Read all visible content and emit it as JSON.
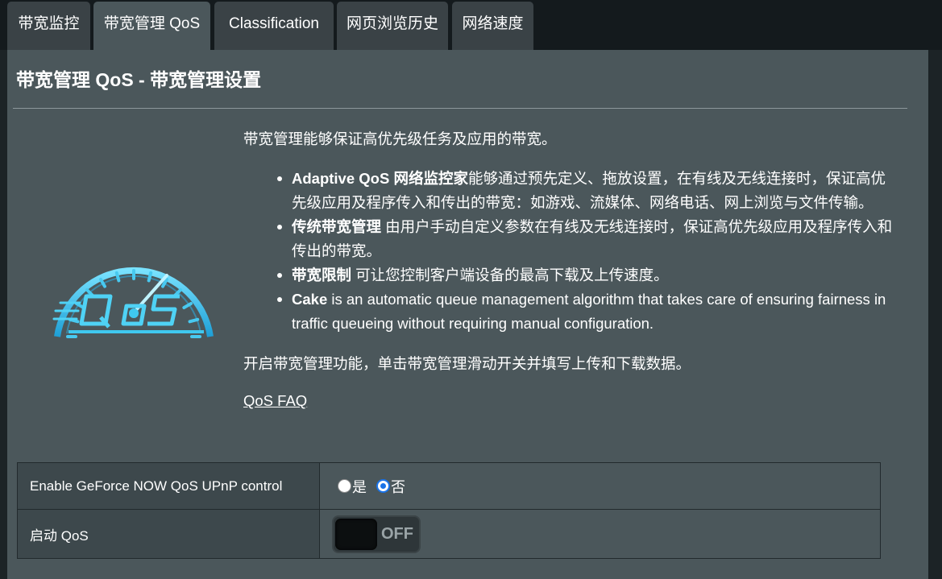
{
  "tabs": [
    {
      "label": "带宽监控",
      "active": false
    },
    {
      "label": "带宽管理 QoS",
      "active": true
    },
    {
      "label": "Classification",
      "active": false
    },
    {
      "label": "网页浏览历史",
      "active": false
    },
    {
      "label": "网络速度",
      "active": false
    }
  ],
  "page": {
    "title": "带宽管理 QoS - 带宽管理设置",
    "logo_icon": "qos-speedometer-icon",
    "intro": "带宽管理能够保证高优先级任务及应用的带宽。",
    "bullets": [
      {
        "bold": "Adaptive QoS 网络监控家",
        "text": "能够通过预先定义、拖放设置，在有线及无线连接时，保证高优先级应用及程序传入和传出的带宽：如游戏、流媒体、网络电话、网上浏览与文件传输。"
      },
      {
        "bold": "传统带宽管理",
        "text": " 由用户手动自定义参数在有线及无线连接时，保证高优先级应用及程序传入和传出的带宽。"
      },
      {
        "bold": "带宽限制",
        "text": " 可让您控制客户端设备的最高下载及上传速度。"
      },
      {
        "bold": "Cake",
        "text": " is an automatic queue management algorithm that takes care of ensuring fairness in traffic queueing without requiring manual configuration."
      }
    ],
    "note": "开启带宽管理功能，单击带宽管理滑动开关并填写上传和下载数据。",
    "faq_link": "QoS FAQ"
  },
  "settings": {
    "geforce": {
      "label": "Enable GeForce NOW QoS UPnP control",
      "options": [
        "是",
        "否"
      ],
      "selected": "否"
    },
    "qos": {
      "label": "启动 QoS",
      "state": "OFF"
    }
  },
  "colors": {
    "accent_blue": "#1a73e8",
    "logo_cyan": "#3fc8ef",
    "panel_bg": "#4b575b"
  }
}
